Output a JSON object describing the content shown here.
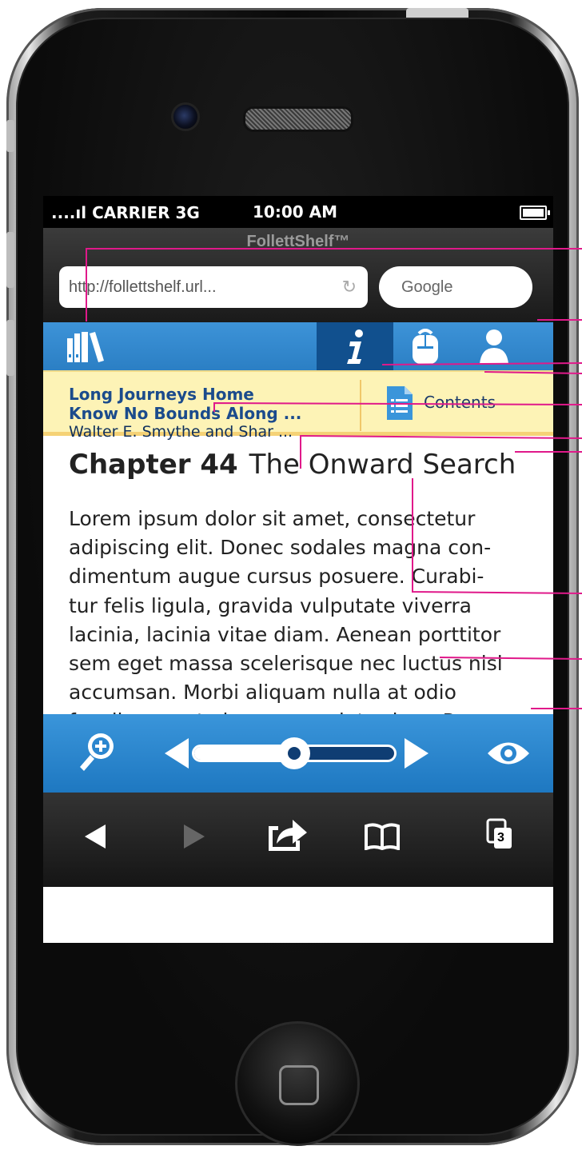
{
  "status_bar": {
    "carrier": "....ıl CARRIER 3G",
    "time": "10:00 AM"
  },
  "browser": {
    "title": "FollettShelf™",
    "url": "http://follettshelf.url...",
    "search_placeholder": "Google"
  },
  "app_bar": {
    "icons": [
      "bookshelf-icon",
      "info-icon",
      "backpack-icon",
      "user-icon"
    ],
    "active": "info-icon"
  },
  "book": {
    "title_line1": "Long Journeys Home",
    "title_line2": "Know No Bounds Along ...",
    "author": "Walter E. Smythe and Shar ...",
    "contents_label": "Contents"
  },
  "chapter": {
    "number_label": "Chapter 44",
    "title": "The Onward Search"
  },
  "body_lines": [
    "Lorem ipsum dolor sit amet, consectetur",
    "adipiscing elit. Donec sodales magna con-",
    "dimentum augue cursus posuere. Curabi-",
    "tur felis ligula, gravida vulputate viverra",
    "lacinia, lacinia vitae diam. Aenean porttitor",
    "sem eget massa scelerisque nec luctus nisl",
    "accumsan. Morbi aliquam nulla at odio",
    "faucibus eget viverra urna interdum. Prae-"
  ],
  "reader_toolbar": {
    "progress": 0.5
  },
  "browser_toolbar": {
    "tabs_count": "3"
  },
  "colors": {
    "app_blue": "#2b86cf",
    "active_tab": "#11508e",
    "book_bar": "#fdf3b6",
    "callout": "#e0198a"
  }
}
